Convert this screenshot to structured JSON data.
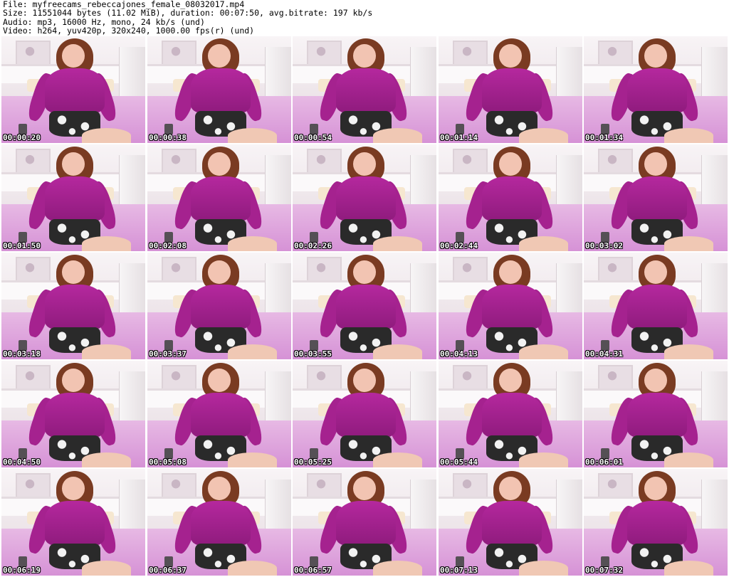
{
  "header": {
    "file_line": "File: myfreecams_rebeccajones_female_08032017.mp4",
    "size_line": "Size: 11551044 bytes (11.02 MiB), duration: 00:07:50, avg.bitrate: 197 kb/s",
    "audio_line": "Audio: mp3, 16000 Hz, mono, 24 kb/s (und)",
    "video_line": "Video: h264, yuv420p, 320x240, 1000.00 fps(r) (und)"
  },
  "thumbnails": [
    {
      "time": "00:00:20"
    },
    {
      "time": "00:00:38"
    },
    {
      "time": "00:00:54"
    },
    {
      "time": "00:01:14"
    },
    {
      "time": "00:01:34"
    },
    {
      "time": "00:01:50"
    },
    {
      "time": "00:02:08"
    },
    {
      "time": "00:02:26"
    },
    {
      "time": "00:02:44"
    },
    {
      "time": "00:03:02"
    },
    {
      "time": "00:03:18"
    },
    {
      "time": "00:03:37"
    },
    {
      "time": "00:03:55"
    },
    {
      "time": "00:04:13"
    },
    {
      "time": "00:04:31"
    },
    {
      "time": "00:04:50"
    },
    {
      "time": "00:05:08"
    },
    {
      "time": "00:05:25"
    },
    {
      "time": "00:05:44"
    },
    {
      "time": "00:06:01"
    },
    {
      "time": "00:06:19"
    },
    {
      "time": "00:06:37"
    },
    {
      "time": "00:06:57"
    },
    {
      "time": "00:07:13"
    },
    {
      "time": "00:07:32"
    }
  ],
  "colors": {
    "background": "#ffffff",
    "header_text": "#000000",
    "timestamp_text": "#ffffff",
    "timestamp_outline": "#000000"
  }
}
